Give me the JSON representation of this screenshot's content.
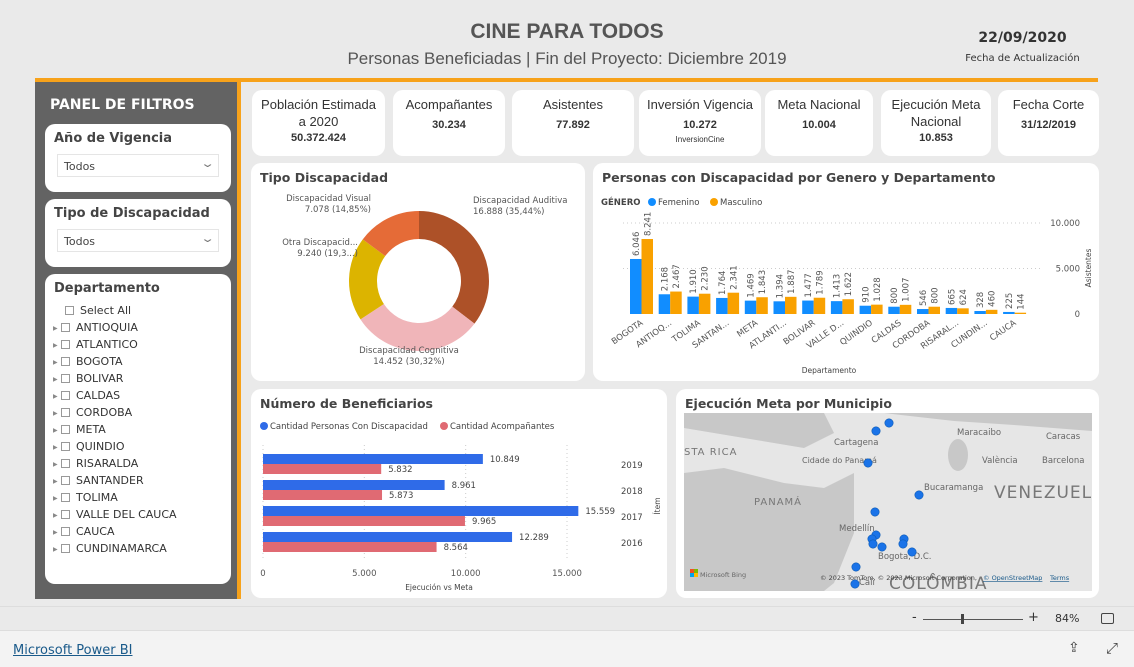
{
  "header": {
    "title": "CINE PARA TODOS",
    "subtitle": "Personas Beneficiadas | Fin del Proyecto: Diciembre 2019",
    "date": "22/09/2020",
    "date_label": "Fecha de Actualización"
  },
  "sidebar": {
    "title": "PANEL DE FILTROS",
    "year_filter": {
      "label": "Año de Vigencia",
      "value": "Todos"
    },
    "type_filter": {
      "label": "Tipo de Discapacidad",
      "value": "Todos"
    },
    "dept_filter": {
      "label": "Departamento",
      "select_all": "Select All",
      "items": [
        "ANTIOQUIA",
        "ATLANTICO",
        "BOGOTA",
        "BOLIVAR",
        "CALDAS",
        "CORDOBA",
        "META",
        "QUINDIO",
        "RISARALDA",
        "SANTANDER",
        "TOLIMA",
        "VALLE DEL CAUCA",
        "CAUCA",
        "CUNDINAMARCA"
      ]
    }
  },
  "kpis": [
    {
      "label": "Población Estimada a 2020",
      "value": "50.372.424"
    },
    {
      "label": "Acompañantes",
      "value": "30.234"
    },
    {
      "label": "Asistentes",
      "value": "77.892"
    },
    {
      "label": "Inversión Vigencia",
      "value": "10.272",
      "sub": "InversionCine"
    },
    {
      "label": "Meta Nacional",
      "value": "10.004"
    },
    {
      "label": "Ejecución Meta Nacional",
      "value": "10.853"
    },
    {
      "label": "Fecha Corte",
      "value": "31/12/2019"
    }
  ],
  "map": {
    "title": "Ejecución Meta por Municipio",
    "labels": [
      "STA RICA",
      "Cartagena",
      "Maracaibo",
      "Caracas",
      "Cidade do Panamá",
      "València",
      "Barcelona",
      "VENEZUELA",
      "PANAMÁ",
      "Bucaramanga",
      "Medellín",
      "Bogota, D.C.",
      "COLÔMBIA",
      "Cali"
    ],
    "bing": "Microsoft Bing",
    "attribution": "© 2023 TomTom, © 2023 Microsoft Corporation,",
    "osm": "© OpenStreetMap",
    "terms": "Terms",
    "point_color": "#1a73e8"
  },
  "zoom": {
    "minus": "-",
    "plus": "+",
    "level": "84%"
  },
  "footer": {
    "link": "Microsoft Power BI"
  },
  "chart_data": [
    {
      "type": "pie",
      "title": "Tipo Discapacidad",
      "donut": true,
      "slices": [
        {
          "name": "Discapacidad Auditiva",
          "value": 16888,
          "label": "16.888 (35,44%)",
          "color": "#ad5128"
        },
        {
          "name": "Discapacidad Cognitiva",
          "value": 14452,
          "label": "14.452 (30,32%)",
          "color": "#f0b5b9"
        },
        {
          "name": "Otra Discapacid...",
          "value": 9240,
          "label": "9.240 (19,3...)",
          "color": "#dcb400"
        },
        {
          "name": "Discapacidad Visual",
          "value": 7078,
          "label": "7.078 (14,85%)",
          "color": "#e56b37"
        }
      ]
    },
    {
      "type": "bar",
      "title": "Personas con Discapacidad por Genero y Departamento",
      "legend_title": "GÉNERO",
      "legend": "top-left",
      "xlabel": "Departamento",
      "ylabel": "Asistentes",
      "ylim": [
        0,
        10000
      ],
      "yticks": [
        "0",
        "5.000",
        "10.000"
      ],
      "grid": true,
      "categories": [
        "BOGOTA",
        "ANTIOQ...",
        "TOLIMA",
        "SANTAN...",
        "META",
        "ATLANTI...",
        "BOLIVAR",
        "VALLE D...",
        "QUINDIO",
        "CALDAS",
        "CORDOBA",
        "RISARAL...",
        "CUNDIN...",
        "CAUCA"
      ],
      "series": [
        {
          "name": "Femenino",
          "color": "#118dff",
          "values": [
            6046,
            2168,
            1910,
            1764,
            1469,
            1394,
            1477,
            1413,
            910,
            800,
            546,
            665,
            328,
            225
          ],
          "labels": [
            "6.046",
            "2.168",
            "1.910",
            "1.764",
            "1.469",
            "1.394",
            "1.477",
            "1.413",
            "910",
            "800",
            "546",
            "665",
            "328",
            "225"
          ]
        },
        {
          "name": "Masculino",
          "color": "#f9a100",
          "values": [
            8241,
            2467,
            2230,
            2341,
            1843,
            1887,
            1789,
            1622,
            1028,
            1007,
            800,
            624,
            460,
            144
          ],
          "labels": [
            "8.241",
            "2.467",
            "2.230",
            "2.341",
            "1.843",
            "1.887",
            "1.789",
            "1.622",
            "1.028",
            "1.007",
            "800",
            "624",
            "460",
            "144"
          ]
        }
      ]
    },
    {
      "type": "bar",
      "orientation": "horizontal",
      "title": "Número de Beneficiarios",
      "legend": "top-left",
      "xlabel": "Ejecución vs Meta",
      "ylabel": "Ítem",
      "xlim": [
        0,
        17500
      ],
      "xticks": [
        "0",
        "5.000",
        "10.000",
        "15.000"
      ],
      "grid": true,
      "categories": [
        "2019",
        "2018",
        "2017",
        "2016"
      ],
      "series": [
        {
          "name": "Cantidad Personas Con Discapacidad",
          "color": "#2f6be8",
          "values": [
            10849,
            8961,
            15559,
            12289
          ],
          "labels": [
            "10.849",
            "8.961",
            "15.559",
            "12.289"
          ]
        },
        {
          "name": "Cantidad Acompañantes",
          "color": "#e06a73",
          "values": [
            5832,
            5873,
            9965,
            8564
          ],
          "labels": [
            "5.832",
            "5.873",
            "9.965",
            "8.564"
          ]
        }
      ]
    }
  ]
}
